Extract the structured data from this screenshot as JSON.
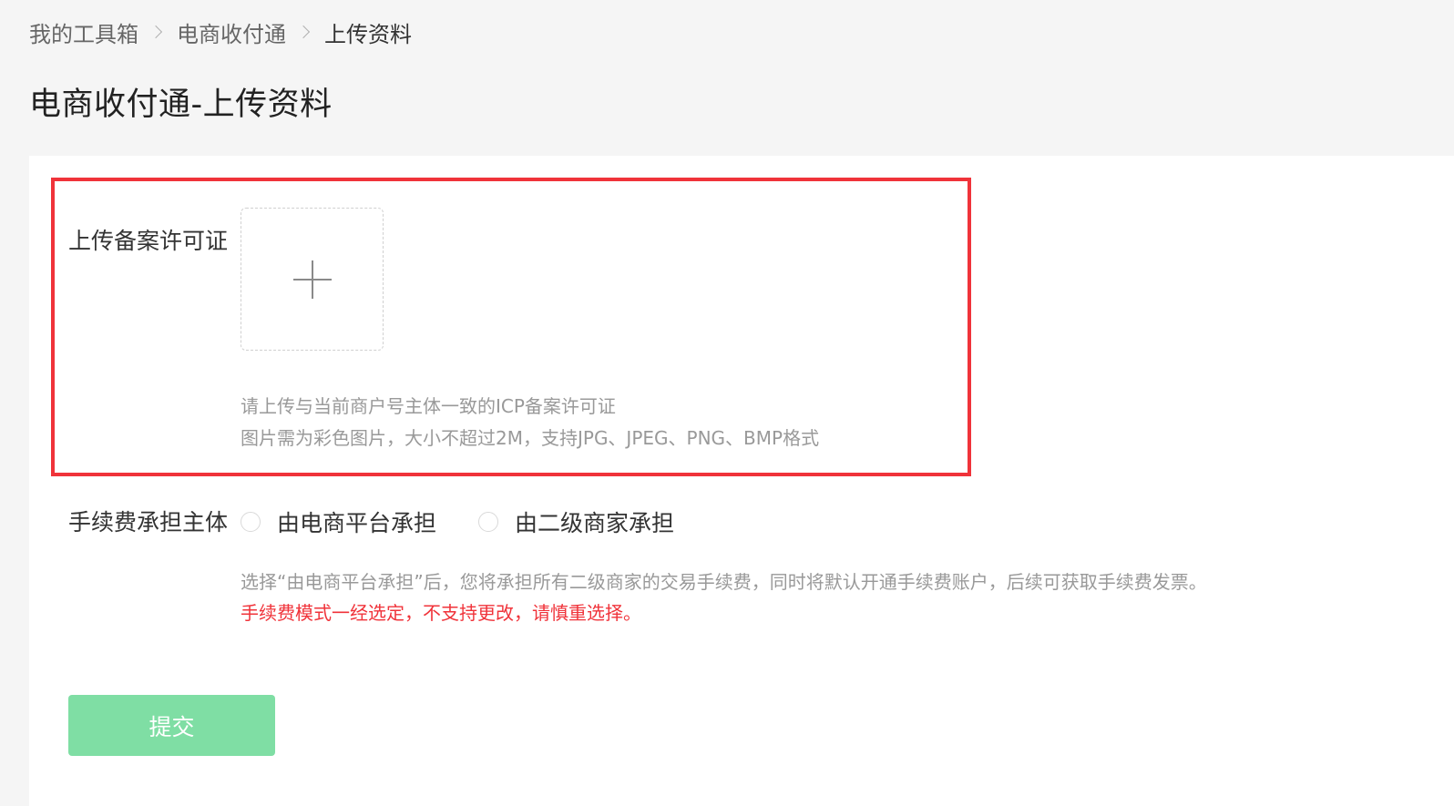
{
  "breadcrumb": {
    "items": [
      "我的工具箱",
      "电商收付通",
      "上传资料"
    ]
  },
  "page": {
    "title": "电商收付通-上传资料"
  },
  "upload": {
    "label": "上传备案许可证",
    "icon": "plus-icon",
    "hint_line1": "请上传与当前商户号主体一致的ICP备案许可证",
    "hint_line2": "图片需为彩色图片，大小不超过2M，支持JPG、JPEG、PNG、BMP格式"
  },
  "fee_bearer": {
    "label": "手续费承担主体",
    "options": [
      {
        "label": "由电商平台承担",
        "selected": false
      },
      {
        "label": "由二级商家承担",
        "selected": false
      }
    ],
    "hint": "选择“由电商平台承担”后，您将承担所有二级商家的交易手续费，同时将默认开通手续费账户，后续可获取手续费发票。",
    "warning": "手续费模式一经选定，不支持更改，请慎重选择。"
  },
  "submit": {
    "label": "提交"
  },
  "colors": {
    "highlight_border": "#f0333a",
    "submit_bg": "#7fdea4",
    "warning_text": "#f0333a"
  }
}
